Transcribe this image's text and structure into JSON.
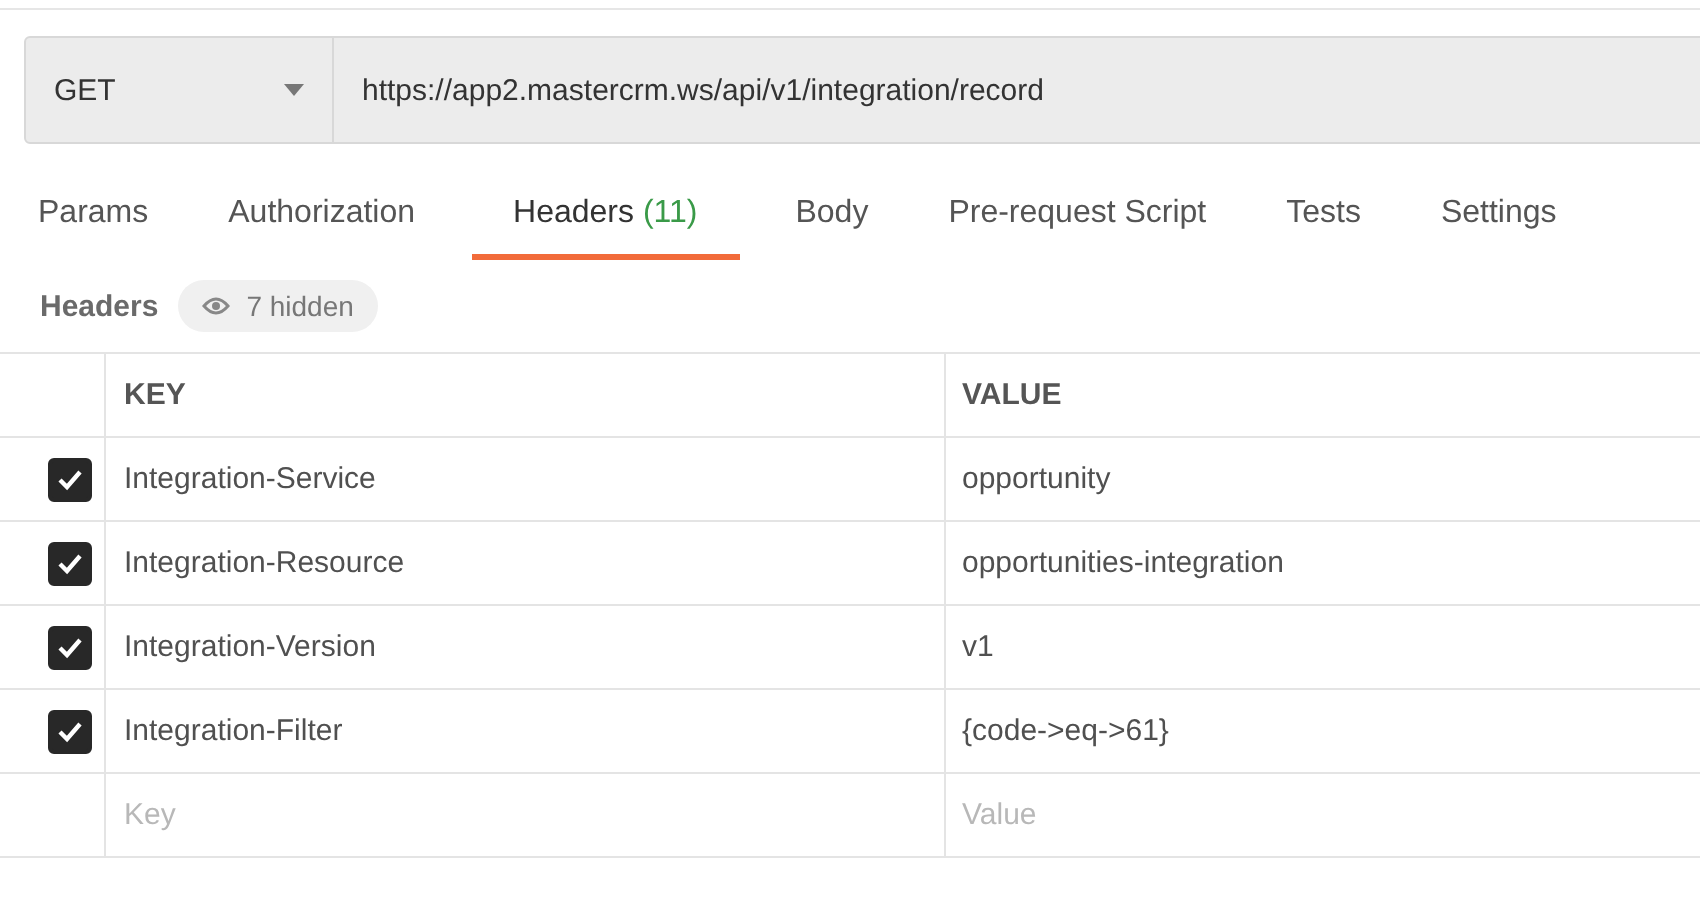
{
  "request": {
    "method": "GET",
    "url": "https://app2.mastercrm.ws/api/v1/integration/record"
  },
  "tabs": [
    {
      "label": "Params",
      "selected": false
    },
    {
      "label": "Authorization",
      "selected": false
    },
    {
      "label": "Headers",
      "count": "(11)",
      "selected": true
    },
    {
      "label": "Body",
      "selected": false
    },
    {
      "label": "Pre-request Script",
      "selected": false
    },
    {
      "label": "Tests",
      "selected": false
    },
    {
      "label": "Settings",
      "selected": false
    }
  ],
  "headers_bar": {
    "title": "Headers",
    "hidden_toggle": "7 hidden"
  },
  "table": {
    "columns": [
      "KEY",
      "VALUE"
    ],
    "rows": [
      {
        "checked": true,
        "key": "Integration-Service",
        "value": "opportunity"
      },
      {
        "checked": true,
        "key": "Integration-Resource",
        "value": "opportunities-integration"
      },
      {
        "checked": true,
        "key": "Integration-Version",
        "value": "v1"
      },
      {
        "checked": true,
        "key": "Integration-Filter",
        "value": "{code->eq->61}"
      }
    ],
    "new_row": {
      "key_placeholder": "Key",
      "value_placeholder": "Value"
    }
  }
}
